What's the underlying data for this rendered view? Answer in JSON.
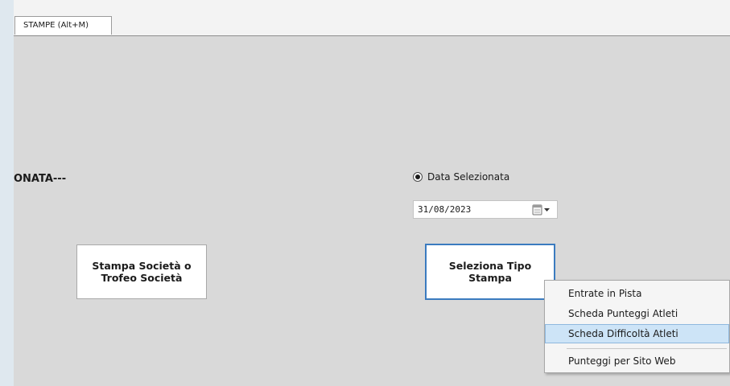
{
  "tabs": [
    {
      "label": "STAMPE (Alt+M)"
    }
  ],
  "section": {
    "label": "ONATA---"
  },
  "buttons": {
    "stampa_societa": {
      "line1": "Stampa Società o",
      "line2": "Trofeo Società"
    },
    "seleziona_tipo": {
      "line1": "Seleziona Tipo",
      "line2": "Stampa"
    }
  },
  "radio": {
    "label": "Data Selezionata",
    "checked": true
  },
  "date_field": {
    "value": "31/08/2023",
    "icon": "calendar-dropdown-icon"
  },
  "menu": {
    "items": [
      {
        "label": "Entrate in Pista",
        "selected": false
      },
      {
        "label": "Scheda Punteggi Atleti",
        "selected": false
      },
      {
        "label": "Scheda Difficoltà Atleti",
        "selected": true
      },
      {
        "label": "Punteggi per Sito Web",
        "selected": false
      }
    ]
  },
  "colors": {
    "background": "#d9d9d9",
    "focus_border": "#3b7bbf",
    "menu_highlight": "#cde4f7"
  }
}
